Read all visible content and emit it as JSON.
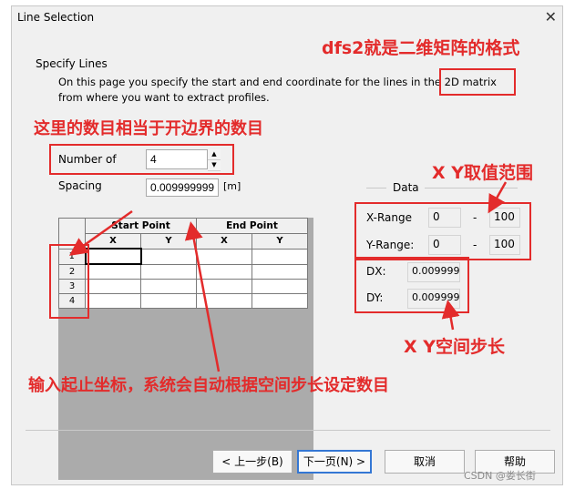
{
  "dialog": {
    "title": "Line Selection",
    "close": "✕"
  },
  "section": {
    "heading": "Specify Lines",
    "desc_line1": "On this page you specify the start and end coordinate for the lines in the 2D matrix",
    "desc_line2": "from where you want to extract profiles."
  },
  "form": {
    "number_label": "Number of",
    "number_value": "4",
    "spacing_label": "Spacing",
    "spacing_value": "0.009999999",
    "spacing_unit": "[m]"
  },
  "table": {
    "group_start": "Start Point",
    "group_end": "End Point",
    "col_x": "X",
    "col_y": "Y",
    "rows": [
      "1",
      "2",
      "3",
      "4"
    ]
  },
  "data_panel": {
    "title": "Data",
    "x_range_label": "X-Range",
    "x_min": "0",
    "x_max": "100",
    "y_range_label": "Y-Range:",
    "y_min": "0",
    "y_max": "100",
    "dash": "-",
    "dx_label": "DX:",
    "dx_value": "0.009999",
    "dy_label": "DY:",
    "dy_value": "0.009999"
  },
  "buttons": {
    "back": "< 上一步(B)",
    "next": "下一页(N) >",
    "cancel": "取消",
    "help": "帮助"
  },
  "annotations": {
    "dfs2": "dfs2就是二维矩阵的格式",
    "number": "这里的数目相当于开边界的数目",
    "range": "X Y取值范围",
    "step": "X Y空间步长",
    "input": "输入起止坐标，系统会自动根据空间步长设定数目"
  },
  "watermark": "CSDN @娄长街",
  "colors": {
    "annotation": "#e32b2b",
    "dialog_bg": "#f0f0f0",
    "primary_border": "#3477d4"
  }
}
